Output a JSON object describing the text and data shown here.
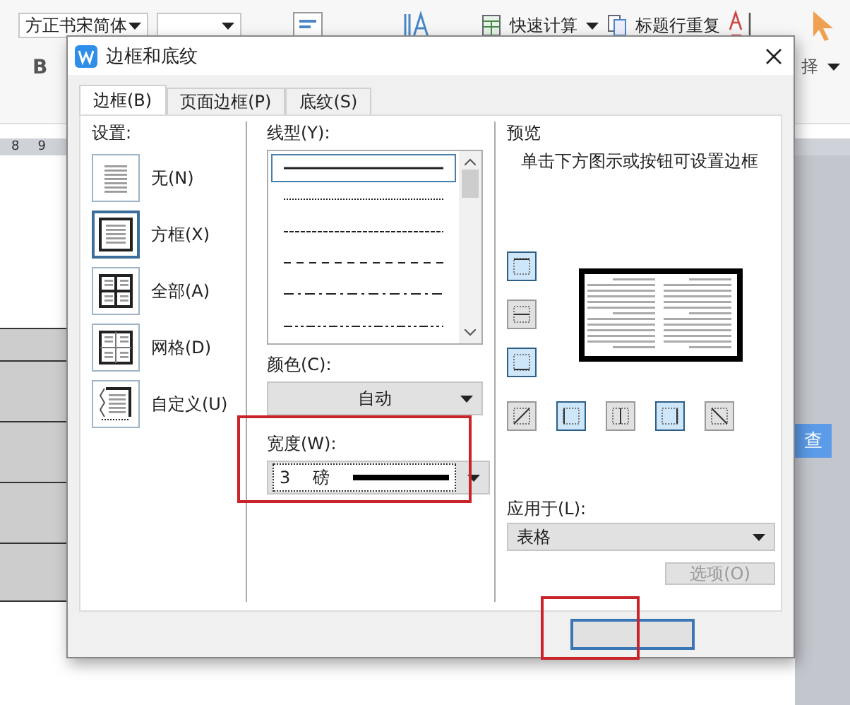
{
  "toolbar": {
    "font_name": "方正书宋简体",
    "bold": "B",
    "quick_calc": "快速计算",
    "repeat_header": "标题行重复",
    "select_partial": "择"
  },
  "ruler": {
    "marks": [
      "8",
      "9"
    ]
  },
  "side_button": "查",
  "dialog": {
    "title": "边框和底纹",
    "tabs": [
      {
        "label": "边框(B)",
        "selected": true
      },
      {
        "label": "页面边框(P)",
        "selected": false
      },
      {
        "label": "底纹(S)",
        "selected": false
      }
    ],
    "settings": {
      "label": "设置:",
      "items": [
        {
          "label": "无(N)",
          "kind": "none",
          "selected": false
        },
        {
          "label": "方框(X)",
          "kind": "box",
          "selected": true
        },
        {
          "label": "全部(A)",
          "kind": "all",
          "selected": false
        },
        {
          "label": "网格(D)",
          "kind": "grid",
          "selected": false
        },
        {
          "label": "自定义(U)",
          "kind": "custom",
          "selected": false
        }
      ]
    },
    "line_style": {
      "label": "线型(Y):",
      "styles": [
        {
          "kind": "solid",
          "selected": true
        },
        {
          "kind": "dotted",
          "selected": false
        },
        {
          "kind": "dashed",
          "selected": false
        },
        {
          "kind": "long-dash",
          "selected": false
        },
        {
          "kind": "dash-dot",
          "selected": false
        },
        {
          "kind": "dash-dot-dot",
          "selected": false
        }
      ]
    },
    "color": {
      "label": "颜色(C):",
      "value": "自动"
    },
    "width": {
      "label": "宽度(W):",
      "value": "3",
      "unit": "磅"
    },
    "preview": {
      "label": "预览",
      "hint": "单击下方图示或按钮可设置边框",
      "side_buttons": [
        {
          "kind": "top",
          "on": true
        },
        {
          "kind": "middle-h",
          "on": false
        },
        {
          "kind": "bottom",
          "on": true
        }
      ],
      "bottom_buttons": [
        {
          "kind": "diag-up",
          "on": false
        },
        {
          "kind": "left",
          "on": true
        },
        {
          "kind": "middle-v",
          "on": false
        },
        {
          "kind": "right",
          "on": true
        },
        {
          "kind": "diag-down",
          "on": false
        }
      ]
    },
    "apply_to": {
      "label": "应用于(L):",
      "value": "表格"
    },
    "options_button": {
      "label": "选项(O)",
      "disabled": true
    }
  }
}
